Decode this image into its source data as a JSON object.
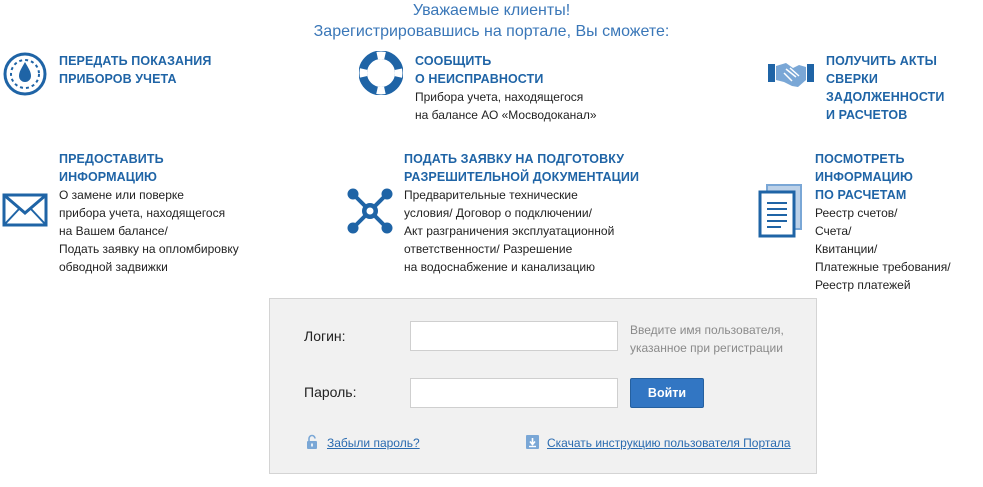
{
  "header": {
    "line1": "Уважаемые клиенты!",
    "line2": "Зарегистрировавшись на портале, Вы сможете:"
  },
  "features": [
    {
      "icon": "gauge-icon",
      "title_lines": [
        "ПЕРЕДАТЬ ПОКАЗАНИЯ",
        "ПРИБОРОВ УЧЕТА"
      ],
      "desc_lines": []
    },
    {
      "icon": "lifebuoy-icon",
      "title_lines": [
        "СООБЩИТЬ",
        "О НЕИСПРАВНОСТИ"
      ],
      "desc_lines": [
        "Прибора учета, находящегося",
        "на балансе АО «Мосводоканал»"
      ]
    },
    {
      "icon": "handshake-icon",
      "title_lines": [
        "ПОЛУЧИТЬ АКТЫ СВЕРКИ",
        "ЗАДОЛЖЕННОСТИ",
        "И РАСЧЕТОВ"
      ],
      "desc_lines": []
    },
    {
      "icon": "envelope-icon",
      "title_lines": [
        "ПРЕДОСТАВИТЬ",
        "ИНФОРМАЦИЮ"
      ],
      "desc_lines": [
        "О замене или поверке",
        "прибора учета, находящегося",
        "на Вашем балансе/",
        "Подать заявку на опломбировку",
        "обводной задвижки"
      ]
    },
    {
      "icon": "network-icon",
      "title_lines": [
        "ПОДАТЬ ЗАЯВКУ НА ПОДГОТОВКУ",
        "РАЗРЕШИТЕЛЬНОЙ ДОКУМЕНТАЦИИ"
      ],
      "desc_lines": [
        "Предварительные технические",
        "условия/ Договор о подключении/",
        "Акт разграничения эксплуатационной",
        "ответственности/ Разрешение",
        "на водоснабжение и канализацию"
      ]
    },
    {
      "icon": "documents-icon",
      "title_lines": [
        "ПОСМОТРЕТЬ ИНФОРМАЦИЮ",
        "ПО РАСЧЕТАМ"
      ],
      "desc_lines": [
        "Реестр счетов/",
        "Счета/",
        "Квитанции/",
        "Платежные требования/",
        "Реестр платежей"
      ]
    }
  ],
  "login": {
    "login_label": "Логин:",
    "login_value": "",
    "login_hint_lines": [
      "Введите имя пользователя,",
      "указанное при регистрации"
    ],
    "password_label": "Пароль:",
    "password_value": "",
    "submit_label": "Войти",
    "forgot_link": "Забыли пароль?",
    "manual_link": "Скачать инструкцию пользователя Портала"
  },
  "colors": {
    "brand_blue": "#1f64a6",
    "header_blue": "#3a77b8",
    "button_blue": "#3276c3",
    "box_bg": "#f1f1f1"
  }
}
